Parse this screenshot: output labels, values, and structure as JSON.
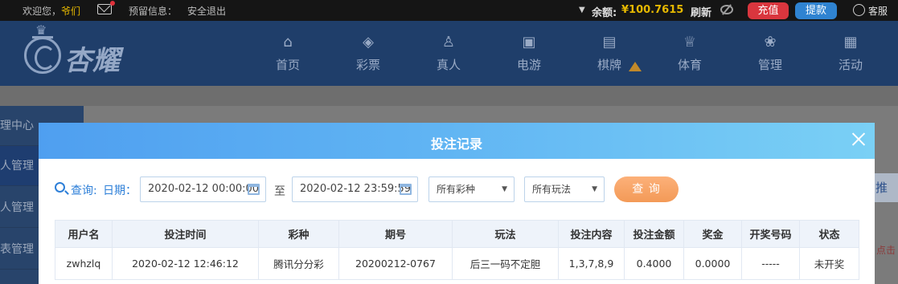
{
  "topbar": {
    "welcome": "欢迎您，",
    "username": "爷们",
    "reserved_label": "预留信息：",
    "logout": "安全退出",
    "balance_label": "余额:",
    "balance_value": "¥100.7615",
    "refresh": "刷新",
    "recharge": "充值",
    "withdraw": "提款",
    "service": "客服",
    "colors": {
      "recharge": "#d9363e",
      "withdraw": "#2f83d1",
      "balance": "#e6b800"
    }
  },
  "logo": {
    "text": "杏耀"
  },
  "nav": [
    {
      "label": "首页",
      "icon": "home-icon",
      "glyph": "⌂"
    },
    {
      "label": "彩票",
      "icon": "lottery-icon",
      "glyph": "◈"
    },
    {
      "label": "真人",
      "icon": "live-icon",
      "glyph": "♙"
    },
    {
      "label": "电游",
      "icon": "slot-icon",
      "glyph": "▣"
    },
    {
      "label": "棋牌",
      "icon": "cards-icon",
      "glyph": "▤"
    },
    {
      "label": "体育",
      "icon": "trophy-icon",
      "glyph": "♕"
    },
    {
      "label": "管理",
      "icon": "users-icon",
      "glyph": "❀"
    },
    {
      "label": "活动",
      "icon": "gift-icon",
      "glyph": "▦"
    }
  ],
  "sidebar": {
    "items": [
      {
        "label": "理中心"
      },
      {
        "label": "人管理"
      },
      {
        "label": "人管理"
      },
      {
        "label": "表管理"
      }
    ]
  },
  "right_peek": {
    "label": "推",
    "link": "点击"
  },
  "modal": {
    "title": "投注记录",
    "filter": {
      "query_label": "查询:",
      "date_label": "日期：",
      "start": "2020-02-12 00:00:00",
      "to": "至",
      "end": "2020-02-12 23:59:59",
      "lottery_select": "所有彩种",
      "play_select": "所有玩法",
      "search_button": "查 询"
    },
    "table": {
      "headers": [
        "用户名",
        "投注时间",
        "彩种",
        "期号",
        "玩法",
        "投注内容",
        "投注金额",
        "奖金",
        "开奖号码",
        "状态"
      ],
      "rows": [
        [
          "zwhzlq",
          "2020-02-12 12:46:12",
          "腾讯分分彩",
          "20200212-0767",
          "后三一码不定胆",
          "1,3,7,8,9",
          "0.4000",
          "0.0000",
          "-----",
          "未开奖"
        ]
      ]
    }
  }
}
